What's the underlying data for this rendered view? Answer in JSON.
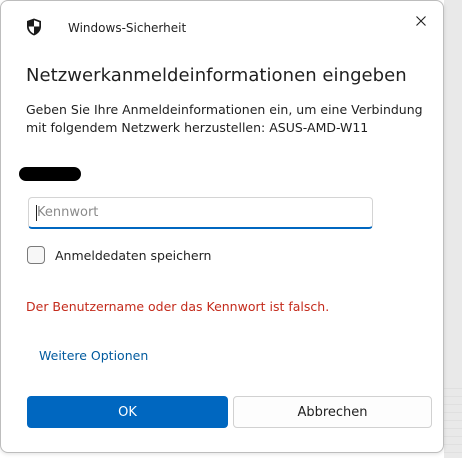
{
  "window": {
    "title": "Windows-Sicherheit",
    "icon": "shield-icon",
    "close_icon": "close-icon"
  },
  "dialog": {
    "heading": "Netzwerkanmeldeinformationen eingeben",
    "description": "Geben Sie Ihre Anmeldeinformationen ein, um eine Verbindung mit folgendem Netzwerk herzustellen: ASUS-AMD-W11",
    "username_label": "",
    "password": {
      "placeholder": "Kennwort",
      "value": ""
    },
    "remember_label": "Anmeldedaten speichern",
    "remember_checked": false,
    "error": "Der Benutzername oder das Kennwort ist falsch.",
    "more_options": "Weitere Optionen"
  },
  "buttons": {
    "ok": "OK",
    "cancel": "Abbrechen"
  },
  "colors": {
    "accent": "#0067c0",
    "error": "#c42b1c",
    "link": "#005a9e"
  }
}
